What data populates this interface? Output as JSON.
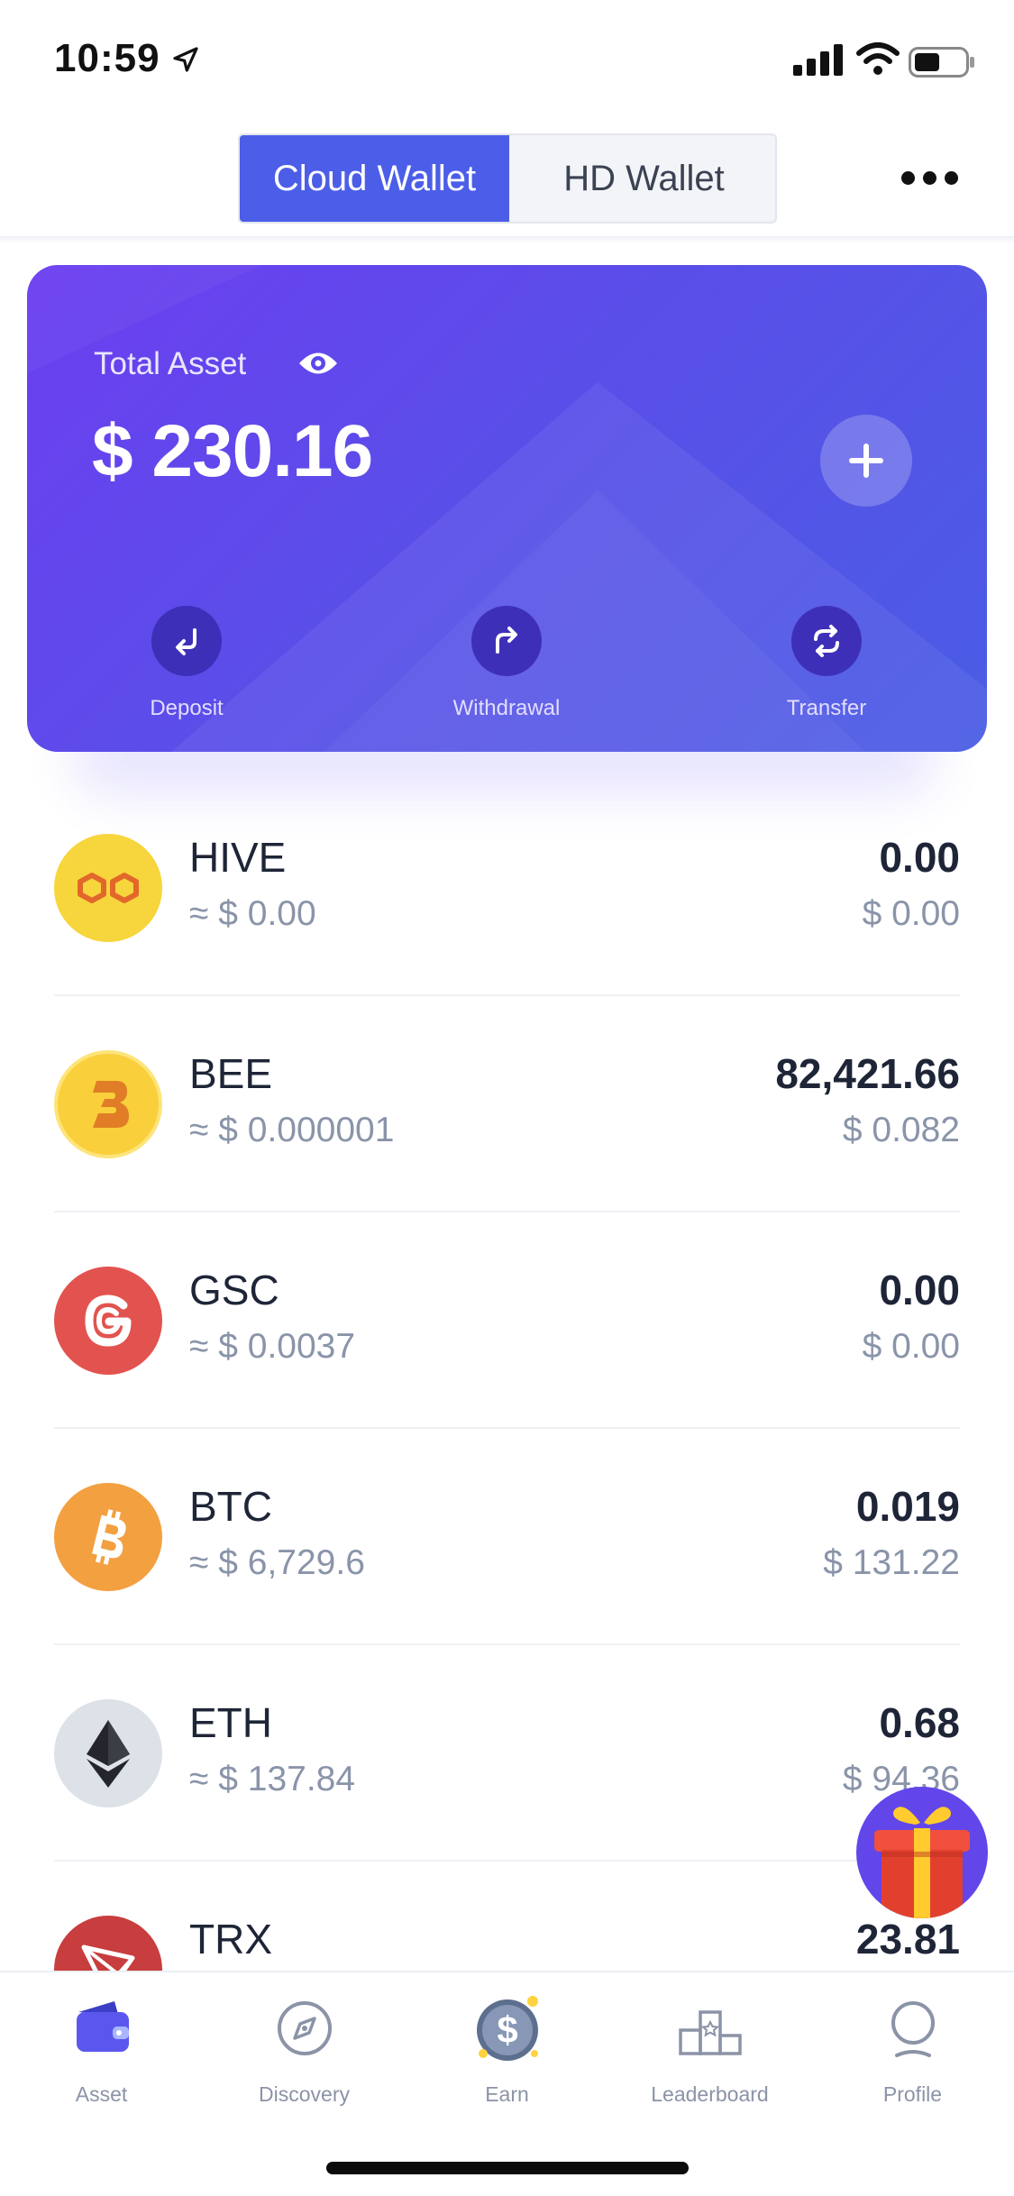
{
  "status_bar": {
    "time": "10:59"
  },
  "header": {
    "tabs": [
      {
        "label": "Cloud Wallet",
        "active": true
      },
      {
        "label": "HD Wallet",
        "active": false
      }
    ]
  },
  "asset_card": {
    "title": "Total Asset",
    "total": "$ 230.16",
    "actions": [
      {
        "label": "Deposit",
        "icon": "deposit-arrow-icon"
      },
      {
        "label": "Withdrawal",
        "icon": "withdrawal-arrow-icon"
      },
      {
        "label": "Transfer",
        "icon": "transfer-cycle-icon"
      }
    ]
  },
  "coins": [
    {
      "symbol": "HIVE",
      "price": "≈ $ 0.00",
      "amount": "0.00",
      "value": "$ 0.00",
      "icon": "hive-logo-icon",
      "color": "#f7d63d"
    },
    {
      "symbol": "BEE",
      "price": "≈ $ 0.000001",
      "amount": "82,421.66",
      "value": "$ 0.082",
      "icon": "bee-logo-icon",
      "color": "#f9cf3c"
    },
    {
      "symbol": "GSC",
      "price": "≈ $ 0.0037",
      "amount": "0.00",
      "value": "$ 0.00",
      "icon": "gsc-logo-icon",
      "color": "#e2534f"
    },
    {
      "symbol": "BTC",
      "price": "≈ $ 6,729.6",
      "amount": "0.019",
      "value": "$ 131.22",
      "icon": "bitcoin-logo-icon",
      "color": "#f3a041"
    },
    {
      "symbol": "ETH",
      "price": "≈ $ 137.84",
      "amount": "0.68",
      "value": "$ 94.36",
      "icon": "ethereum-logo-icon",
      "color": "#dde1e8"
    },
    {
      "symbol": "TRX",
      "price": "",
      "amount": "23.81",
      "value": "",
      "icon": "tron-logo-icon",
      "color": "#c83d3d"
    }
  ],
  "tabbar": {
    "items": [
      {
        "label": "Asset",
        "icon": "wallet-icon",
        "active": true
      },
      {
        "label": "Discovery",
        "icon": "compass-icon",
        "active": false
      },
      {
        "label": "Earn",
        "icon": "dollar-coin-icon",
        "active": false
      },
      {
        "label": "Leaderboard",
        "icon": "podium-icon",
        "active": false
      },
      {
        "label": "Profile",
        "icon": "profile-icon",
        "active": false
      }
    ]
  },
  "colors": {
    "accent": "#4c5ee8",
    "card_start": "#6c3ef0",
    "card_end": "#4a5de4",
    "muted_text": "#8a94a9"
  }
}
